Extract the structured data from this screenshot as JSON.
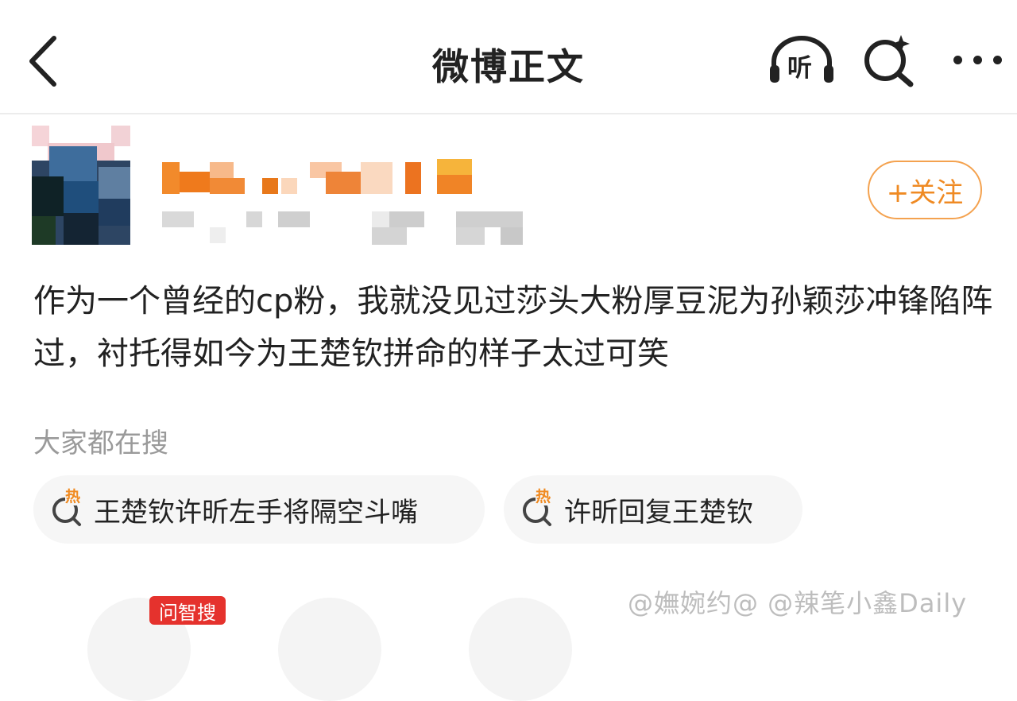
{
  "header": {
    "title": "微博正文",
    "listen_label": "听",
    "back_icon": "chevron-left-icon",
    "search_icon": "search-sparkle-icon",
    "more_icon": "more-dots-icon"
  },
  "post": {
    "follow_label": "+关注",
    "text": "作为一个曾经的cp粉，我就没见过莎头大粉厚豆泥为孙颖莎冲锋陷阵过，衬托得如今为王楚钦拼命的样子太过可笑"
  },
  "trending": {
    "label": "大家都在搜",
    "hot_label": "热",
    "items": [
      "王楚钦许昕左手将隔空斗嘴",
      "许昕回复王楚钦"
    ]
  },
  "bottom": {
    "ai_badge": "问智搜",
    "watermark": "@嫵婉约@ @辣笔小鑫Daily"
  },
  "colors": {
    "accent": "#ef8a23",
    "badge_red": "#e5322d",
    "muted_text": "#9a9a9a"
  }
}
